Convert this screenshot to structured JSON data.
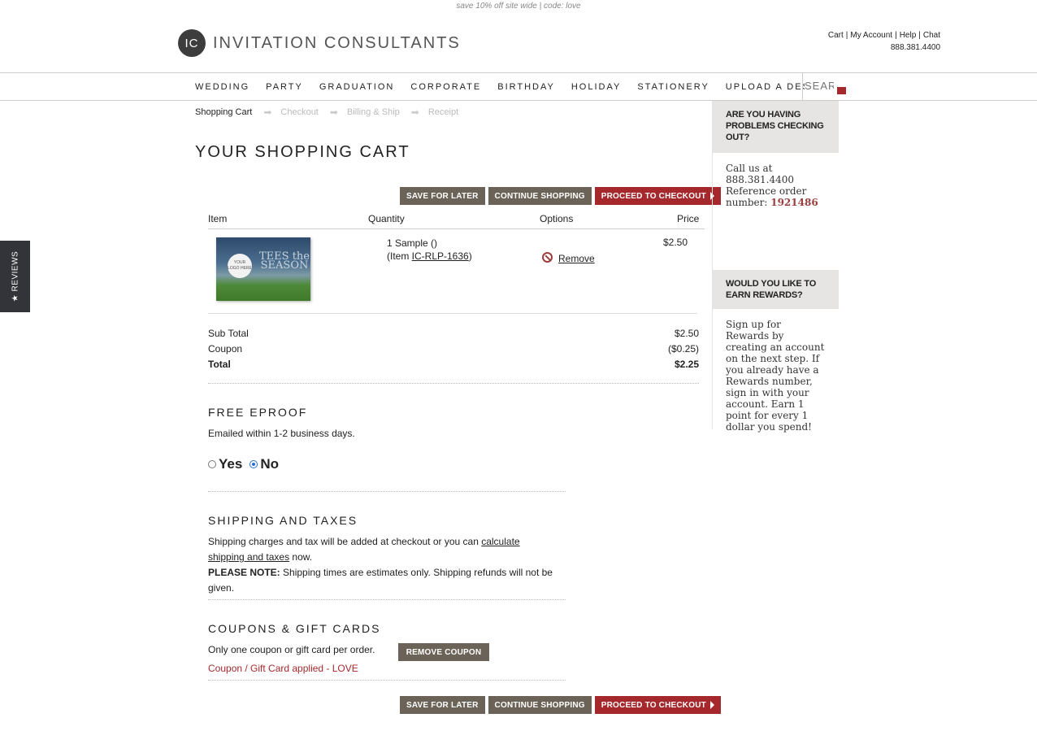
{
  "promo_banner": "save 10% off site wide | code: love",
  "logo": {
    "mark": "IC",
    "text": "INVITATION CONSULTANTS"
  },
  "top_links": {
    "cart": "Cart",
    "account": "My Account",
    "help": "Help",
    "chat": "Chat",
    "phone": "888.381.4400"
  },
  "nav": [
    "WEDDING",
    "PARTY",
    "GRADUATION",
    "CORPORATE",
    "BIRTHDAY",
    "HOLIDAY",
    "STATIONERY",
    "UPLOAD A DESIGN"
  ],
  "search": {
    "placeholder": "SEAR"
  },
  "reviews_tab": "★ REVIEWS",
  "breadcrumb": [
    "Shopping Cart",
    "Checkout",
    "Billing & Ship",
    "Receipt"
  ],
  "page_title": "YOUR SHOPPING CART",
  "buttons": {
    "save_later": "SAVE FOR LATER",
    "continue": "CONTINUE SHOPPING",
    "checkout": "PROCEED TO CHECKOUT",
    "remove_coupon": "REMOVE COUPON"
  },
  "cart_headers": {
    "item": "Item",
    "quantity": "Quantity",
    "options": "Options",
    "price": "Price"
  },
  "cart_item": {
    "qty_line": "1 Sample ()",
    "item_prefix": "(Item ",
    "item_code": "IC-RLP-1636",
    "item_suffix": ")",
    "remove": "Remove",
    "price": "$2.50",
    "image": {
      "ball": "YOUR LOGO HERE",
      "text": "TEES the SEASON"
    }
  },
  "totals": [
    {
      "label": "Sub Total",
      "value": "$2.50"
    },
    {
      "label": "Coupon",
      "value": "($0.25)"
    },
    {
      "label": "Total",
      "value": "$2.25"
    }
  ],
  "eproof": {
    "title": "FREE EPROOF",
    "text": "Emailed within 1-2 business days.",
    "yes": "Yes",
    "no": "No",
    "selected": "No"
  },
  "shipping": {
    "title": "SHIPPING AND TAXES",
    "text_before": "Shipping charges and tax will be added at checkout or you can ",
    "link": "calculate shipping and taxes",
    "text_after": " now.",
    "note_label": "PLEASE NOTE:",
    "note_text": " Shipping times are estimates only. Shipping refunds will not be given."
  },
  "coupons": {
    "title": "COUPONS & GIFT CARDS",
    "text": "Only one coupon or gift card per order.",
    "applied": "Coupon / Gift Card applied - LOVE"
  },
  "sidebar": {
    "help_title": "ARE YOU HAVING PROBLEMS CHECKING OUT?",
    "help_text_1": "Call us at 888.381.4400 Reference order number: ",
    "order_number": "1921486",
    "rewards_title": "WOULD YOU LIKE TO EARN REWARDS?",
    "rewards_text": "Sign up for Rewards by creating an account on the next step. If you already have a Rewards number, sign in with your account. Earn 1 point for every 1 dollar you spend!"
  },
  "colors": {
    "accent": "#a5292c",
    "button_grey": "#6b6357",
    "sidebar_bg": "#e6e5e3"
  }
}
